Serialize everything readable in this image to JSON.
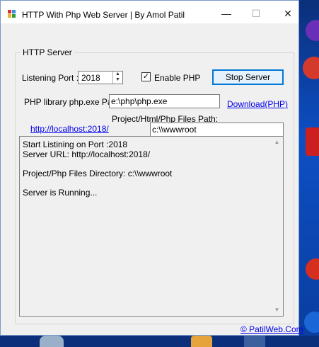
{
  "window": {
    "title": "HTTP With Php Web Server | By Amol Patil",
    "minimize_glyph": "—",
    "maximize_glyph": "☐",
    "close_glyph": "✕"
  },
  "group": {
    "label": "HTTP Server"
  },
  "port": {
    "label": "Listening Port :",
    "value": "2018"
  },
  "enable_php": {
    "label": "Enable PHP",
    "checked": true,
    "check_glyph": "✓"
  },
  "stop_button": {
    "label": "Stop Server"
  },
  "php_path": {
    "label": "PHP library php.exe Path:",
    "value": "e:\\php\\php.exe"
  },
  "download_link": {
    "label": "Download(PHP)"
  },
  "project_path": {
    "label": "Project/Html/Php Files Path:",
    "value": "c:\\\\wwwroot"
  },
  "localhost_link": {
    "label": "http://localhost:2018/"
  },
  "log": {
    "lines": [
      "Start Listining on Port :2018",
      "Server URL: http://localhost:2018/",
      "",
      "Project/Php Files Directory: c:\\\\wwwroot",
      "",
      "Server is Running..."
    ]
  },
  "footer_link": {
    "label": "© PatilWeb.Com"
  },
  "colors": {
    "accent": "#0078d7",
    "link": "#0000ee",
    "desktop": "#0d4fc4"
  }
}
